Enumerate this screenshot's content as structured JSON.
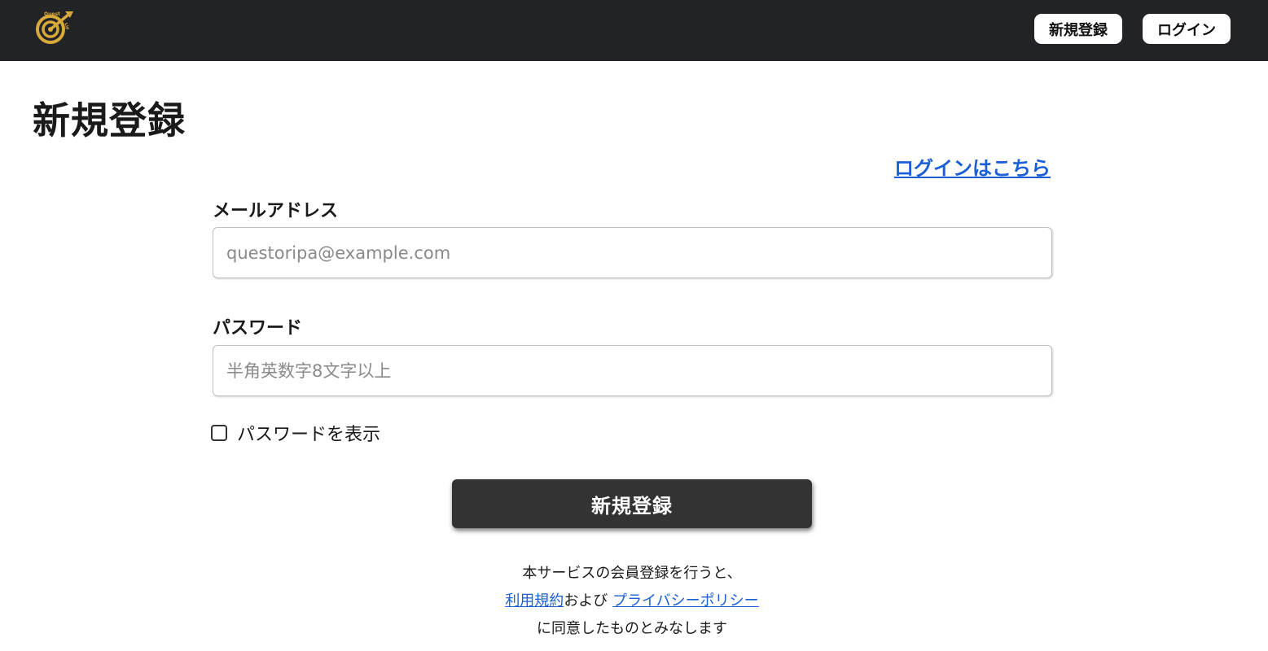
{
  "header": {
    "logo_text": "Quest Lip",
    "logo_icon": "target-arrow-logo-icon",
    "signup_label": "新規登録",
    "login_label": "ログイン",
    "bar_color": "#212327",
    "logo_color": "#d9a93a"
  },
  "main": {
    "title": "新規登録",
    "login_link": "ログインはこちら",
    "email": {
      "label": "メールアドレス",
      "placeholder": "questoripa@example.com",
      "value": ""
    },
    "password": {
      "label": "パスワード",
      "placeholder": "半角英数字8文字以上",
      "value": ""
    },
    "show_password": {
      "label": "パスワードを表示",
      "checked": false
    },
    "submit_label": "新規登録"
  },
  "notice": {
    "line1": "本サービスの会員登録を行うと、",
    "terms_link": "利用規約",
    "and_text": "および",
    "privacy_link": "プライバシーポリシー",
    "line3": "に同意したものとみなします"
  },
  "colors": {
    "link": "#1a5fd6",
    "button_bg": "#333333"
  }
}
